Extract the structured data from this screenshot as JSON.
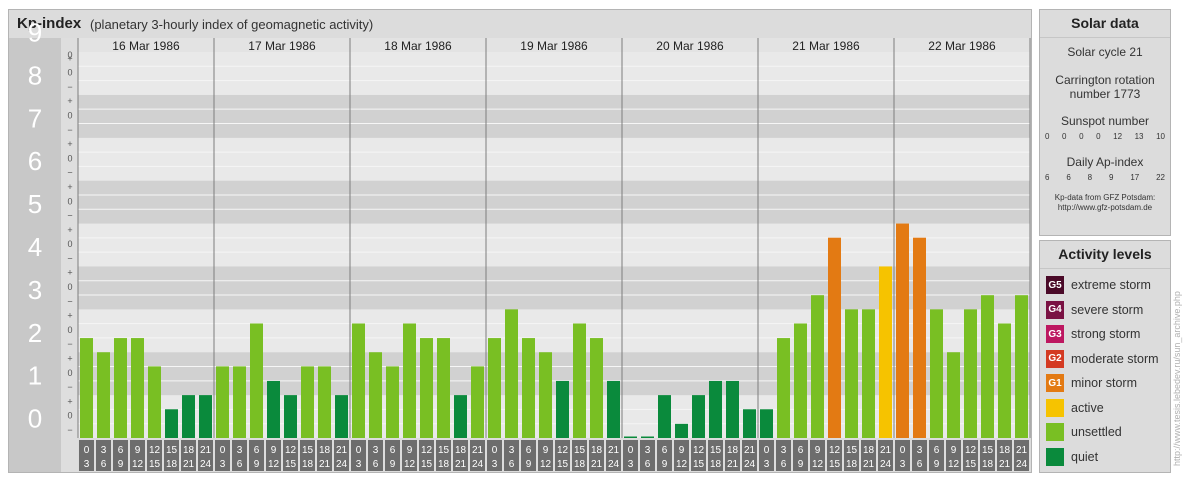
{
  "header": {
    "title": "Kp-index",
    "subtitle": "(planetary 3-hourly index of geomagnetic activity)"
  },
  "chart_data": {
    "type": "bar",
    "title": "Kp-index",
    "subtitle": "(planetary 3-hourly index of geomagnetic activity)",
    "ylim": [
      0,
      9
    ],
    "y_ticks": [
      "0",
      "1",
      "2",
      "3",
      "4",
      "5",
      "6",
      "7",
      "8",
      "9"
    ],
    "thirds_ticks": [
      "−",
      "0",
      "+"
    ],
    "days": [
      "16 Mar 1986",
      "17 Mar 1986",
      "18 Mar 1986",
      "19 Mar 1986",
      "20 Mar 1986",
      "21 Mar 1986",
      "22 Mar 1986"
    ],
    "interval_labels": [
      [
        "0",
        "3"
      ],
      [
        "3",
        "6"
      ],
      [
        "6",
        "9"
      ],
      [
        "9",
        "12"
      ],
      [
        "12",
        "15"
      ],
      [
        "15",
        "18"
      ],
      [
        "18",
        "21"
      ],
      [
        "21",
        "24"
      ]
    ],
    "values": [
      [
        2.33,
        2.0,
        2.33,
        2.33,
        1.67,
        0.67,
        1.0,
        1.0
      ],
      [
        1.67,
        1.67,
        2.67,
        1.33,
        1.0,
        1.67,
        1.67,
        1.0
      ],
      [
        2.67,
        2.0,
        1.67,
        2.67,
        2.33,
        2.33,
        1.0,
        1.67
      ],
      [
        2.33,
        3.0,
        2.33,
        2.0,
        1.33,
        2.67,
        2.33,
        1.33
      ],
      [
        0.0,
        0.0,
        1.0,
        0.33,
        1.0,
        1.33,
        1.33,
        0.67
      ],
      [
        0.67,
        2.33,
        2.67,
        3.33,
        4.67,
        3.0,
        3.0,
        4.0
      ],
      [
        5.0,
        4.67,
        3.0,
        2.0,
        3.0,
        3.33,
        2.67,
        3.33
      ]
    ],
    "colors": {
      "quiet": "#0a8a3c",
      "unsettled": "#79bf23",
      "active": "#f6c300",
      "G1": "#e37a13"
    },
    "grid": true
  },
  "solar": {
    "title": "Solar data",
    "cycle": "Solar cycle 21",
    "carrington_line1": "Carrington rotation",
    "carrington_line2": "number 1773",
    "sunspot_label": "Sunspot number",
    "sunspot_values": [
      "0",
      "0",
      "0",
      "0",
      "12",
      "13",
      "10"
    ],
    "ap_label": "Daily Ap-index",
    "ap_values": [
      "6",
      "6",
      "8",
      "9",
      "17",
      "22"
    ],
    "credit_line1": "Kp-data from GFZ Potsdam:",
    "credit_line2": "http://www.gfz-potsdam.de"
  },
  "activity": {
    "title": "Activity levels",
    "items": [
      {
        "badge": "G5",
        "label": "extreme storm",
        "color": "#4a0a28"
      },
      {
        "badge": "G4",
        "label": "severe storm",
        "color": "#7a1243"
      },
      {
        "badge": "G3",
        "label": "strong storm",
        "color": "#bd1760"
      },
      {
        "badge": "G2",
        "label": "moderate storm",
        "color": "#d43a22"
      },
      {
        "badge": "G1",
        "label": "minor storm",
        "color": "#e37a13"
      },
      {
        "badge": "",
        "label": "active",
        "color": "#f6c300"
      },
      {
        "badge": "",
        "label": "unsettled",
        "color": "#79bf23"
      },
      {
        "badge": "",
        "label": "quiet",
        "color": "#0a8a3c"
      }
    ]
  },
  "watermark": "http://www.tesis.lebedev.ru/sun_archive.php"
}
